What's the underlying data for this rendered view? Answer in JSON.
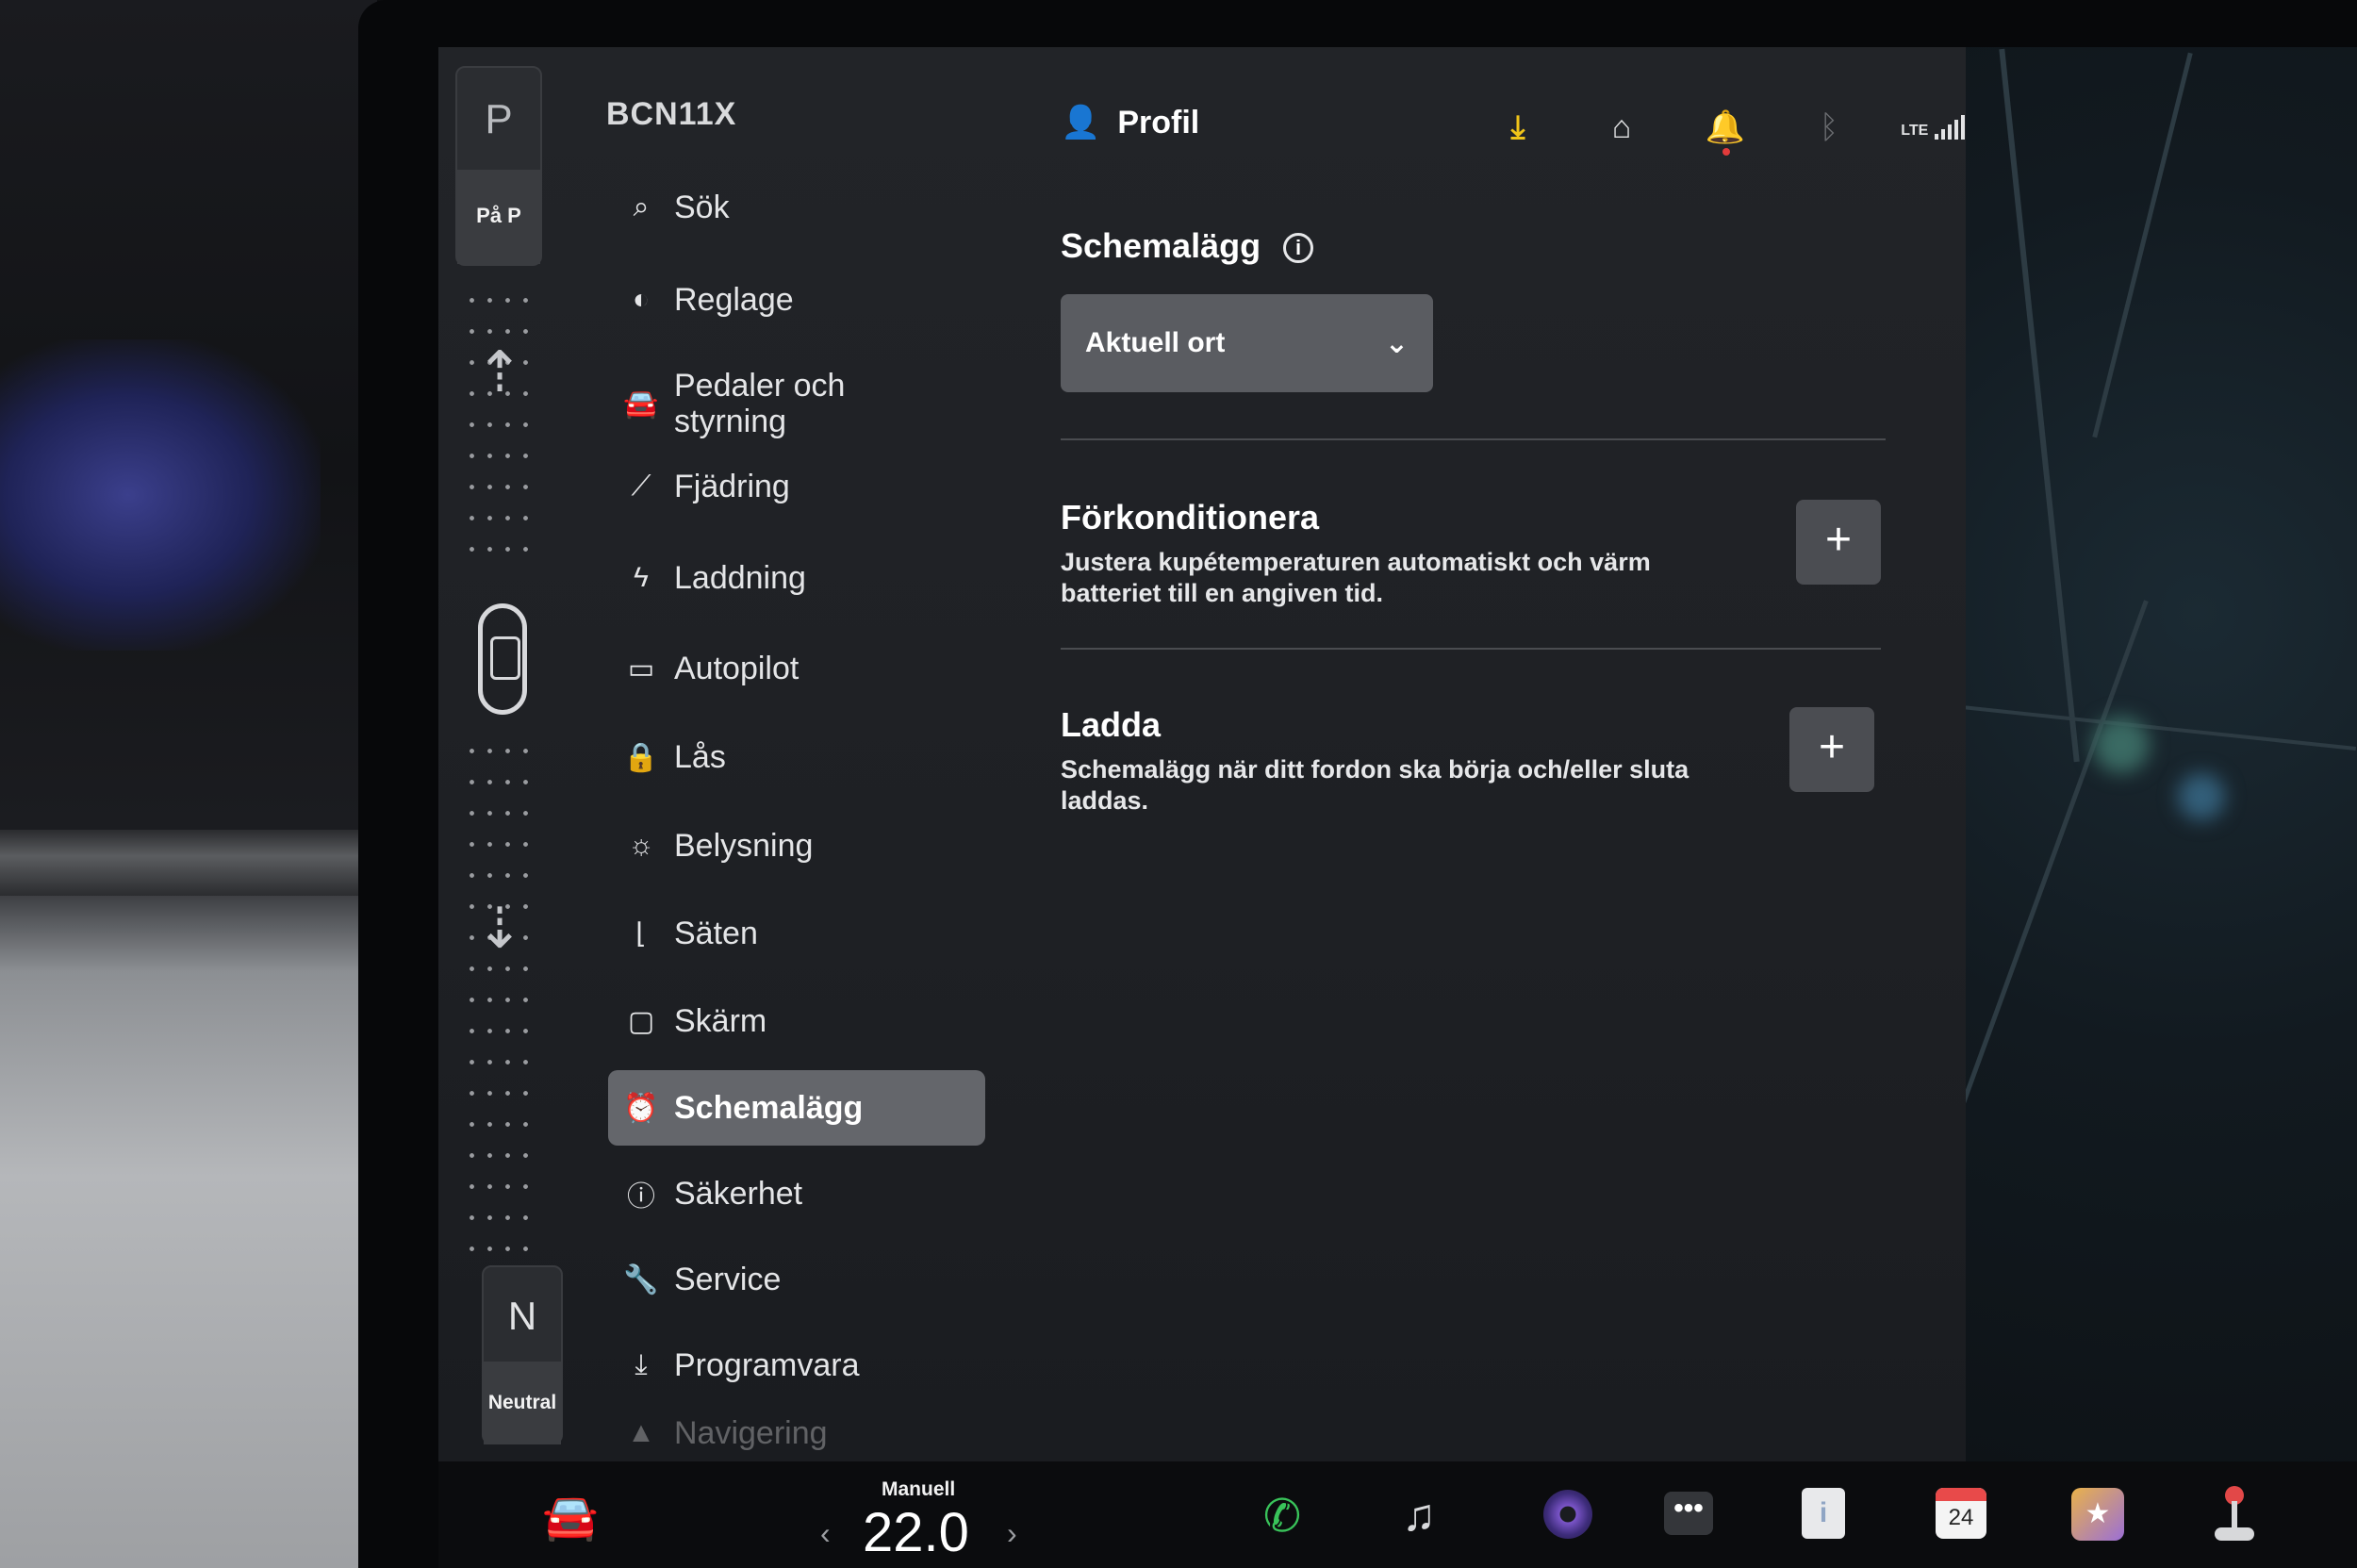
{
  "gear": {
    "park_letter": "P",
    "park_sub": "På P",
    "neutral_letter": "N",
    "neutral_sub": "Neutral"
  },
  "sidebar": {
    "car_name": "BCN11X",
    "items": [
      {
        "label": "Sök",
        "icon": "search-icon",
        "glyph": "⌕"
      },
      {
        "label": "Reglage",
        "icon": "toggle-icon",
        "glyph": "◐"
      },
      {
        "label": "Pedaler och styrning",
        "icon": "car-icon",
        "glyph": "🚘"
      },
      {
        "label": "Fjädring",
        "icon": "suspension-icon",
        "glyph": "⟋"
      },
      {
        "label": "Laddning",
        "icon": "lightning-icon",
        "glyph": "ϟ"
      },
      {
        "label": "Autopilot",
        "icon": "steering-icon",
        "glyph": "▭"
      },
      {
        "label": "Lås",
        "icon": "lock-icon",
        "glyph": "🔒"
      },
      {
        "label": "Belysning",
        "icon": "light-icon",
        "glyph": "☼"
      },
      {
        "label": "Säten",
        "icon": "seat-icon",
        "glyph": "⌊"
      },
      {
        "label": "Skärm",
        "icon": "display-icon",
        "glyph": "▢"
      },
      {
        "label": "Schemalägg",
        "icon": "alarm-clock-icon",
        "glyph": "⏰",
        "active": true
      },
      {
        "label": "Säkerhet",
        "icon": "safety-icon",
        "glyph": "ⓘ"
      },
      {
        "label": "Service",
        "icon": "wrench-icon",
        "glyph": "🔧"
      },
      {
        "label": "Programvara",
        "icon": "software-download-icon",
        "glyph": "⤓"
      },
      {
        "label": "Navigering",
        "icon": "navigation-icon",
        "glyph": "▲"
      }
    ]
  },
  "header": {
    "profile_label": "Profil",
    "lte_label": "LTE"
  },
  "main": {
    "schedule": {
      "title": "Schemalägg",
      "info_glyph": "i",
      "dropdown_value": "Aktuell ort",
      "dropdown_chevron": "⌄"
    },
    "precondition": {
      "title": "Förkonditionera",
      "description": "Justera kupétemperaturen automatiskt och värm batteriet till en angiven tid.",
      "button_glyph": "+"
    },
    "charge": {
      "title": "Ladda",
      "description": "Schemalägg när ditt fordon ska börja och/eller sluta laddas.",
      "button_glyph": "+"
    }
  },
  "bottom_bar": {
    "temp_mode": "Manuell",
    "temperature": "22.0",
    "temp_left": "‹",
    "temp_right": "›",
    "calendar_day": "24",
    "notes_glyph": "i"
  },
  "colors": {
    "accent_download": "#f0c419",
    "active_item_bg": "#64666b",
    "notification_dot": "#e23b3b"
  }
}
